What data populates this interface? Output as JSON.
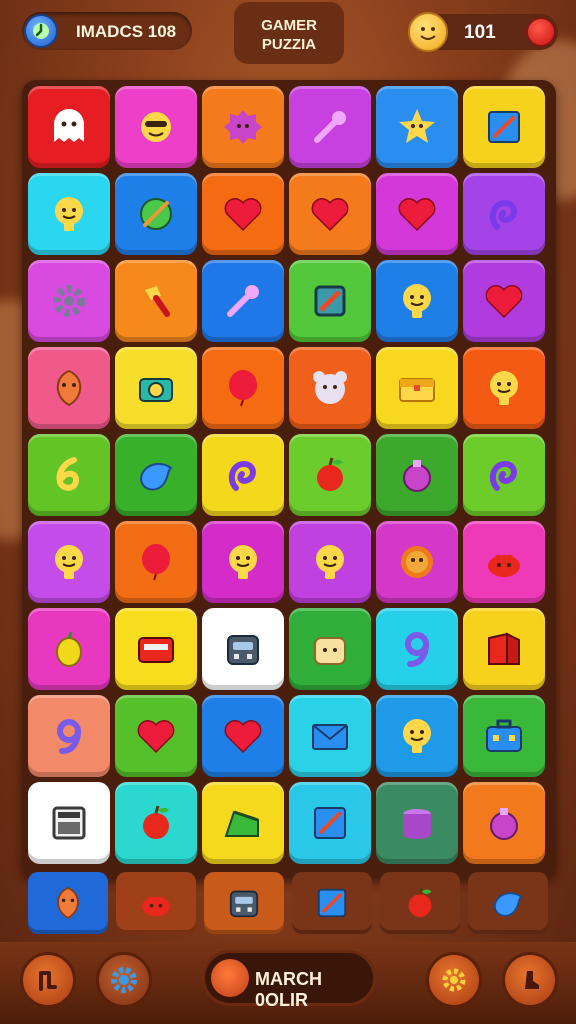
{
  "header": {
    "left_label": "IMADCS 108",
    "title_line1": "GAMER",
    "title_line2": "PUZZIA",
    "score": "101"
  },
  "board": {
    "rows": [
      [
        {
          "color": "#e61e24",
          "icon": "ghost-icon"
        },
        {
          "color": "#ee3fc8",
          "icon": "face-glasses-icon"
        },
        {
          "color": "#f47a1c",
          "icon": "blob-icon"
        },
        {
          "color": "#c741e0",
          "icon": "wand-icon"
        },
        {
          "color": "#2a8ef0",
          "icon": "star-icon"
        },
        {
          "color": "#f7d21c",
          "icon": "pencil-icon"
        }
      ],
      [
        {
          "color": "#2ad6f0",
          "icon": "face-icon"
        },
        {
          "color": "#1f7fe8",
          "icon": "globe-icon"
        },
        {
          "color": "#f46b12",
          "icon": "heart-icon"
        },
        {
          "color": "#f47a1c",
          "icon": "heart-icon"
        },
        {
          "color": "#d438d8",
          "icon": "heart-icon"
        },
        {
          "color": "#a443e8",
          "icon": "swirl-icon"
        }
      ],
      [
        {
          "color": "#d94ae0",
          "icon": "gear-icon"
        },
        {
          "color": "#f6881c",
          "icon": "hammer-icon"
        },
        {
          "color": "#1f78e8",
          "icon": "wand-icon"
        },
        {
          "color": "#52c83a",
          "icon": "frame-icon"
        },
        {
          "color": "#1f7fe8",
          "icon": "face-icon"
        },
        {
          "color": "#b03ce0",
          "icon": "heart-icon"
        }
      ],
      [
        {
          "color": "#f05a8a",
          "icon": "leaf-icon"
        },
        {
          "color": "#f6de2a",
          "icon": "camera-icon"
        },
        {
          "color": "#f46b12",
          "icon": "balloon-icon"
        },
        {
          "color": "#f0601a",
          "icon": "bear-icon"
        },
        {
          "color": "#f8d81e",
          "icon": "chest-icon"
        },
        {
          "color": "#f45a14",
          "icon": "face-icon"
        }
      ],
      [
        {
          "color": "#62c425",
          "icon": "six-icon"
        },
        {
          "color": "#38b02a",
          "icon": "bird-icon"
        },
        {
          "color": "#f4d81c",
          "icon": "swirl-icon"
        },
        {
          "color": "#6ccc2c",
          "icon": "apple-icon"
        },
        {
          "color": "#3ca82c",
          "icon": "bottle-icon"
        },
        {
          "color": "#6ecc2a",
          "icon": "swirl-icon"
        }
      ],
      [
        {
          "color": "#c44ce8",
          "icon": "face-icon"
        },
        {
          "color": "#f26c14",
          "icon": "balloon-icon"
        },
        {
          "color": "#d42cc8",
          "icon": "face-icon"
        },
        {
          "color": "#c040e0",
          "icon": "face-icon"
        },
        {
          "color": "#d438c8",
          "icon": "sun-icon"
        },
        {
          "color": "#ee3ab8",
          "icon": "crab-icon"
        }
      ],
      [
        {
          "color": "#e838c0",
          "icon": "fruit-icon"
        },
        {
          "color": "#f8dc1e",
          "icon": "radio-icon"
        },
        {
          "color": "#ffffff",
          "icon": "robot-icon"
        },
        {
          "color": "#2fae3a",
          "icon": "toast-icon"
        },
        {
          "color": "#26d0e8",
          "icon": "nine-icon"
        },
        {
          "color": "#f7d21c",
          "icon": "book-icon"
        }
      ],
      [
        {
          "color": "#f28a6a",
          "icon": "nine-icon"
        },
        {
          "color": "#56c02a",
          "icon": "heart-icon"
        },
        {
          "color": "#1f7fe8",
          "icon": "heart-icon"
        },
        {
          "color": "#2ad2e8",
          "icon": "envelope-icon"
        },
        {
          "color": "#1f9ae8",
          "icon": "face-icon"
        },
        {
          "color": "#3ab83a",
          "icon": "briefcase-icon"
        }
      ],
      [
        {
          "color": "#ffffff",
          "icon": "calculator-icon"
        },
        {
          "color": "#2ad8d0",
          "icon": "apple-icon"
        },
        {
          "color": "#f6d81c",
          "icon": "cake-icon"
        },
        {
          "color": "#2ac8e8",
          "icon": "pencil-icon"
        },
        {
          "color": "#3a8a62",
          "icon": "coins-icon"
        },
        {
          "color": "#f27a1c",
          "icon": "bottle-icon"
        }
      ]
    ]
  },
  "tray": [
    {
      "color": "#1f6ad8",
      "icon": "leaf-icon"
    },
    {
      "color": "#a04018",
      "icon": "crab-icon"
    },
    {
      "color": "#c85a1a",
      "icon": "robot-icon"
    },
    {
      "color": "#7a3418",
      "icon": "pencil-icon"
    },
    {
      "color": "#7a3418",
      "icon": "apple-icon"
    },
    {
      "color": "#7a3418",
      "icon": "bird-icon"
    }
  ],
  "bottom": {
    "match_label": "MARCH 0OLIR",
    "left_buttons": [
      "path-icon",
      "gear-icon"
    ],
    "right_buttons": [
      "gear-icon",
      "boot-icon"
    ]
  }
}
